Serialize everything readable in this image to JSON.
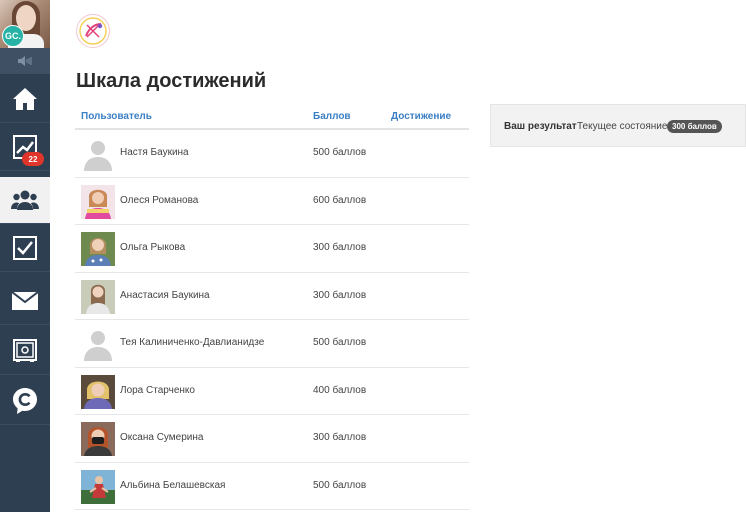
{
  "sidebar": {
    "user_initials": "GC.",
    "stats_badge": "22",
    "items": [
      {
        "icon": "home-icon"
      },
      {
        "icon": "stats-icon"
      },
      {
        "icon": "users-icon",
        "active": true
      },
      {
        "icon": "checkbox-icon"
      },
      {
        "icon": "mail-icon"
      },
      {
        "icon": "safe-icon"
      },
      {
        "icon": "coin-c-icon"
      }
    ]
  },
  "page": {
    "title": "Шкала достижений"
  },
  "table": {
    "columns": {
      "user": "Пользователь",
      "points": "Баллов",
      "achievement": "Достижение"
    },
    "rows": [
      {
        "name": "Настя Баукина",
        "points": "500 баллов",
        "avatar": "placeholder"
      },
      {
        "name": "Олеся Романова",
        "points": "600 баллов",
        "avatar": "photo"
      },
      {
        "name": "Ольга Рыкова",
        "points": "300 баллов",
        "avatar": "photo"
      },
      {
        "name": "Анастасия Баукина",
        "points": "300 баллов",
        "avatar": "photo"
      },
      {
        "name": "Тея Калиниченко-Давлианидзе",
        "points": "500 баллов",
        "avatar": "placeholder"
      },
      {
        "name": "Лора Старченко",
        "points": "400 баллов",
        "avatar": "photo"
      },
      {
        "name": "Оксана Сумерина",
        "points": "300 баллов",
        "avatar": "photo"
      },
      {
        "name": "Альбина Белашевская",
        "points": "500 баллов",
        "avatar": "photo"
      }
    ]
  },
  "result": {
    "label": "Ваш результат",
    "state": "Текущее состояние",
    "badge": "300 баллов"
  },
  "colors": {
    "sidebar_bg": "#2f3f52",
    "accent_link": "#3b7fc4",
    "badge_red": "#e0352b",
    "initials_teal": "#26b3a6"
  }
}
